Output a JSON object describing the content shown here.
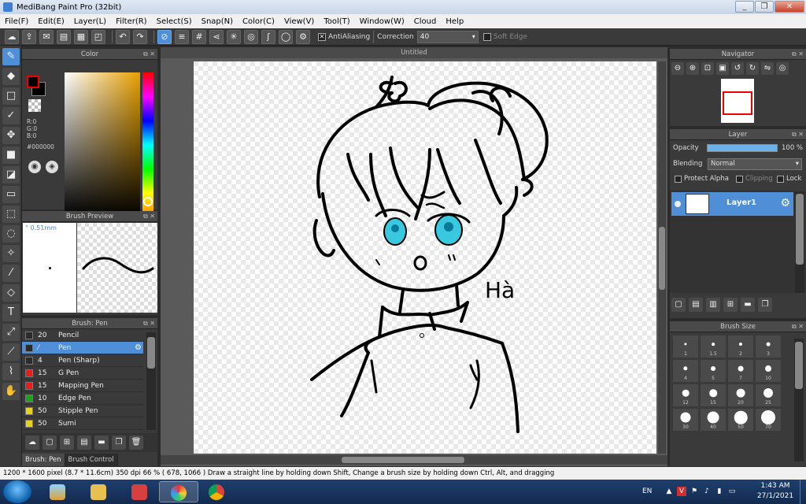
{
  "window": {
    "title": "MediBang Paint Pro (32bit)",
    "minimize": "_",
    "restore": "❐",
    "close": "✕"
  },
  "menu": [
    "File(F)",
    "Edit(E)",
    "Layer(L)",
    "Filter(R)",
    "Select(S)",
    "Snap(N)",
    "Color(C)",
    "View(V)",
    "Tool(T)",
    "Window(W)",
    "Cloud",
    "Help"
  ],
  "options": {
    "antialiasing_label": "AntiAliasing",
    "antialiasing_checked": "✕",
    "correction_label": "Correction",
    "correction_value": "40",
    "softedge_label": "Soft Edge"
  },
  "color_panel": {
    "title": "Color",
    "rgb": [
      "R:0",
      "G:0",
      "B:0"
    ],
    "hex": "#000000",
    "fg_color": "#000000",
    "accent": "#e8a000"
  },
  "brush_preview": {
    "title": "Brush Preview",
    "size": "° 0.51mm"
  },
  "brush_list": {
    "title": "Brush: Pen",
    "items": [
      {
        "size": "20",
        "name": "Pencil",
        "color": "#2b2b2b"
      },
      {
        "size": "⁄",
        "name": "Pen",
        "color": "#2b2b2b",
        "selected": true
      },
      {
        "size": "4",
        "name": "Pen (Sharp)",
        "color": "#2b2b2b"
      },
      {
        "size": "15",
        "name": "G Pen",
        "color": "#e02020"
      },
      {
        "size": "15",
        "name": "Mapping Pen",
        "color": "#e02020"
      },
      {
        "size": "10",
        "name": "Edge Pen",
        "color": "#20a020"
      },
      {
        "size": "50",
        "name": "Stipple Pen",
        "color": "#e8d020"
      },
      {
        "size": "50",
        "name": "Sumi",
        "color": "#e8d020"
      }
    ],
    "tabs": [
      "Brush: Pen",
      "Brush Control"
    ]
  },
  "canvas": {
    "tab_title": "Untitled",
    "signature": "Hà"
  },
  "navigator": {
    "title": "Navigator"
  },
  "layer_panel": {
    "title": "Layer",
    "opacity_label": "Opacity",
    "opacity_value": "100 %",
    "opacity_fraction": 1.0,
    "blending_label": "Blending",
    "blending_value": "Normal",
    "protect_alpha": "Protect Alpha",
    "clipping": "Clipping",
    "lock": "Lock",
    "layer_name": "Layer1"
  },
  "brush_size": {
    "title": "Brush Size",
    "sizes": [
      "1",
      "1.5",
      "2",
      "3",
      "4",
      "5",
      "7",
      "10",
      "12",
      "15",
      "20",
      "25",
      "30",
      "40",
      "50",
      "70"
    ]
  },
  "status": {
    "text": "1200 * 1600 pixel   (8.7 * 11.6cm)   350 dpi   66 %   ( 678, 1066 )   Draw a straight line by holding down Shift, Change a brush size by holding down Ctrl, Alt, and dragging"
  },
  "taskbar": {
    "lang": "EN",
    "time": "1:43 AM",
    "date": "27/1/2021"
  }
}
